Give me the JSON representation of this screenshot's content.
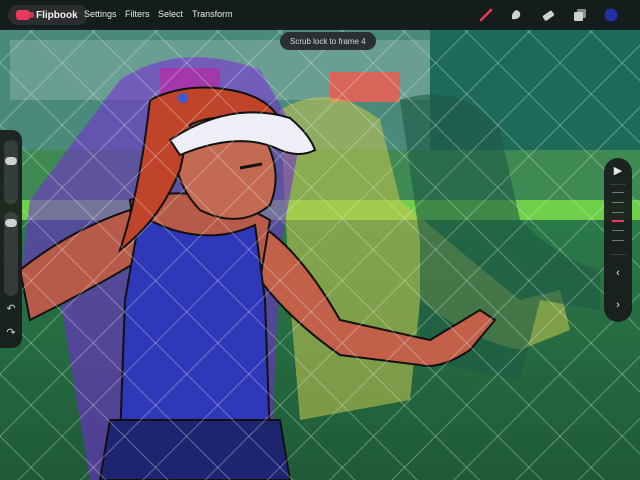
{
  "app": {
    "name": "Flipbook"
  },
  "menu": {
    "settings": "Settings",
    "filters": "Filters",
    "select": "Select",
    "transform": "Transform"
  },
  "toast": {
    "text": "Scrub lock to frame 4"
  },
  "tools": [
    {
      "name": "brush-icon",
      "color": "#e83a5b"
    },
    {
      "name": "smudge-icon",
      "color": "#d0d0d0"
    },
    {
      "name": "eraser-icon",
      "color": "#d0d0d0"
    },
    {
      "name": "layers-icon",
      "color": "#d0d0d0"
    },
    {
      "name": "color-swatch-icon",
      "color": "#2230a8"
    }
  ],
  "player": {
    "play_glyph": "▶",
    "prev_glyph": "‹",
    "next_glyph": "›"
  },
  "history": {
    "undo_glyph": "↶",
    "redo_glyph": "↷"
  }
}
